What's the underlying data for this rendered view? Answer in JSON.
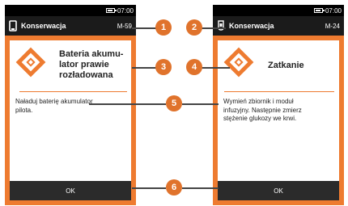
{
  "left_screen": {
    "status": {
      "time": "07:00"
    },
    "header": {
      "title": "Konserwacja",
      "code": "M-59"
    },
    "card": {
      "title_lines": [
        "Bateria akumu-",
        "lator prawie",
        "rozładowana"
      ],
      "message_lines": [
        "Naładuj baterię akumulator",
        "pilota."
      ],
      "ok_label": "OK"
    }
  },
  "right_screen": {
    "status": {
      "time": "07:00"
    },
    "header": {
      "title": "Konserwacja",
      "code": "M-24"
    },
    "card": {
      "title": "Zatkanie",
      "message_lines": [
        "Wymień zbiornik i moduł",
        "infuzyjny. Następnie zmierz",
        "stężenie glukozy we krwi."
      ],
      "ok_label": "OK"
    }
  },
  "callouts": [
    "1",
    "2",
    "3",
    "4",
    "5",
    "6"
  ],
  "icons": {
    "remote": "remote-icon",
    "pump": "pump-icon",
    "warning": "warning-diamond-icon",
    "battery": "battery-icon"
  },
  "colors": {
    "accent": "#ee7b30",
    "callout": "#e0732c",
    "header": "#1b1b1b",
    "button": "#2b2b2b"
  }
}
